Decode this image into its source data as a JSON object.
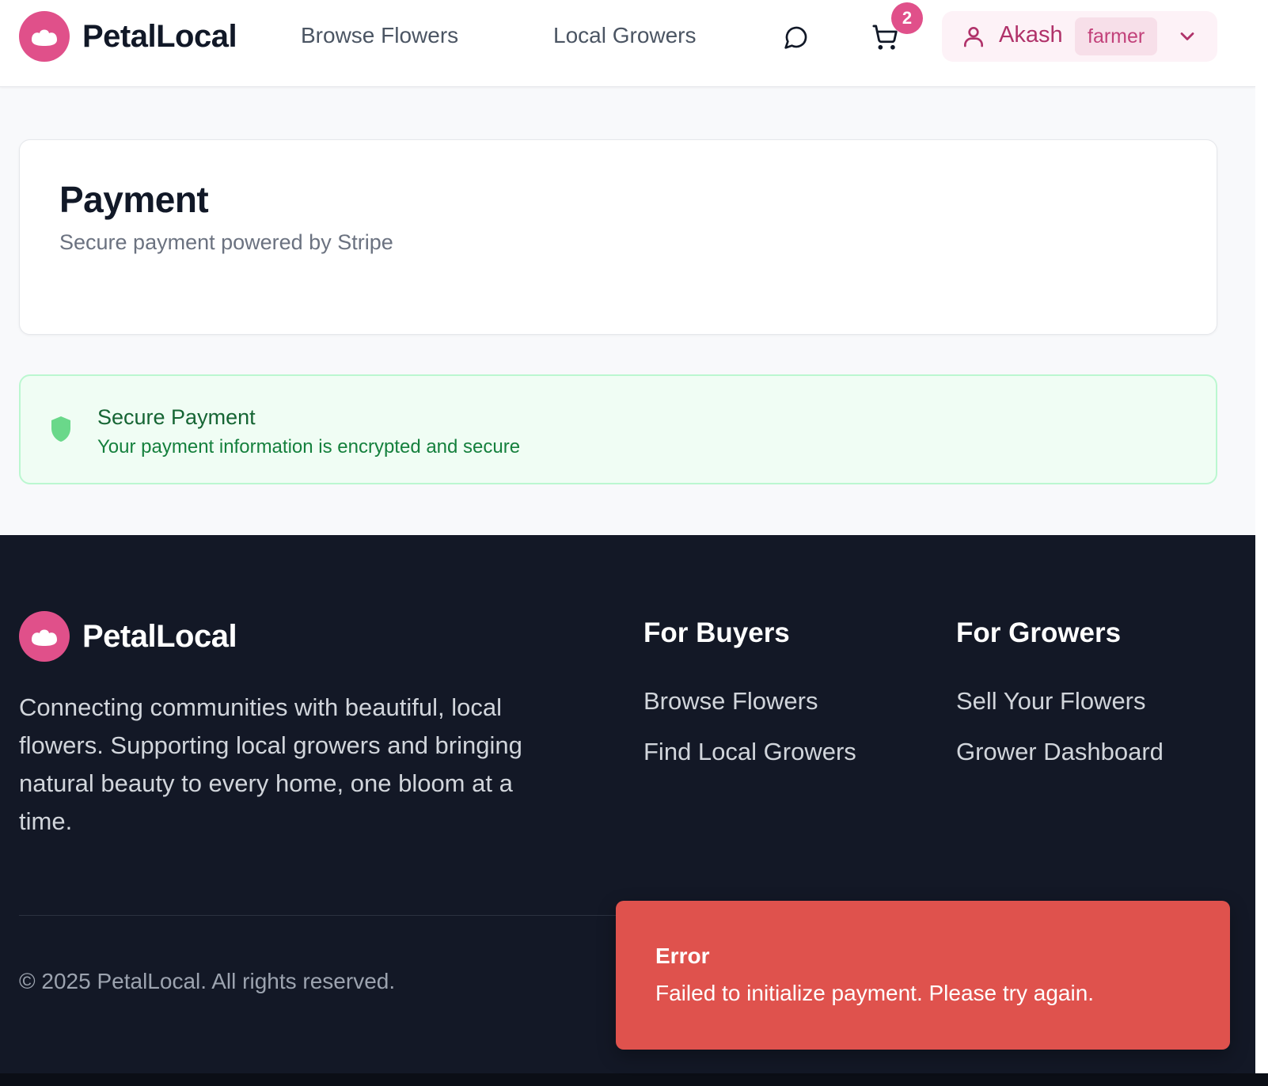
{
  "header": {
    "brand": "PetalLocal",
    "nav": [
      {
        "label": "Browse Flowers"
      },
      {
        "label": "Local Growers"
      }
    ],
    "chat_icon": "message-circle-icon",
    "cart_icon": "shopping-cart-icon",
    "cart_count": "2",
    "user": {
      "icon": "user-icon",
      "name": "Akash",
      "role": "farmer",
      "chevron_icon": "chevron-down-icon"
    }
  },
  "payment": {
    "title": "Payment",
    "subtitle": "Secure payment powered by Stripe"
  },
  "secure_notice": {
    "icon": "shield-icon",
    "title": "Secure Payment",
    "text": "Your payment information is encrypted and secure"
  },
  "footer": {
    "brand": "PetalLocal",
    "description": "Connecting communities with beautiful, local flowers. Supporting local growers and bringing natural beauty to every home, one bloom at a time.",
    "columns": [
      {
        "heading": "For Buyers",
        "links": [
          "Browse Flowers",
          "Find Local Growers"
        ]
      },
      {
        "heading": "For Growers",
        "links": [
          "Sell Your Flowers",
          "Grower Dashboard"
        ]
      }
    ],
    "copyright": "© 2025 PetalLocal. All rights reserved."
  },
  "toast": {
    "title": "Error",
    "message": "Failed to initialize payment. Please try again."
  },
  "colors": {
    "brand_pink": "#e0508a",
    "footer_bg": "#131826",
    "success_bg": "#f0fdf4",
    "success_text": "#166534",
    "error_bg": "#df524d"
  }
}
